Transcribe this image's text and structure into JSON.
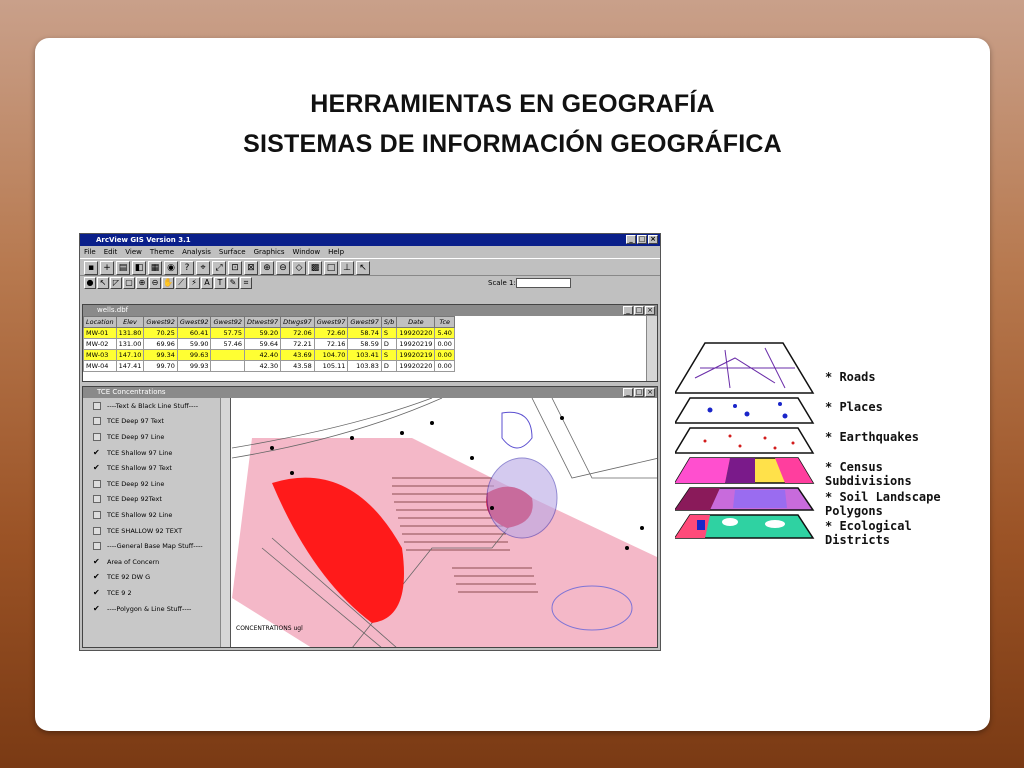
{
  "slide": {
    "title_line1": "HERRAMIENTAS EN GEOGRAFÍA",
    "title_line2": "SISTEMAS DE INFORMACIÓN GEOGRÁFICA"
  },
  "arcview": {
    "window_title": "ArcView GIS Version 3.1",
    "menu": [
      "File",
      "Edit",
      "View",
      "Theme",
      "Analysis",
      "Surface",
      "Graphics",
      "Window",
      "Help"
    ],
    "scale_label": "Scale 1:",
    "table": {
      "title": "wells.dbf",
      "columns": [
        "Location",
        "Elev",
        "Gwest92",
        "Gwest92",
        "Gwest92",
        "Dtwest97",
        "Dtwgs97",
        "Gwest97",
        "Gwest97",
        "S/b",
        "Date",
        "Tce"
      ],
      "rows": [
        {
          "highlight": true,
          "cells": [
            "MW-01",
            "131.80",
            "70.25",
            "60.41",
            "57.75",
            "59.20",
            "72.06",
            "72.60",
            "58.74",
            "S",
            "19920220",
            "5.40"
          ]
        },
        {
          "highlight": false,
          "cells": [
            "MW-02",
            "131.00",
            "69.96",
            "59.90",
            "57.46",
            "59.64",
            "72.21",
            "72.16",
            "58.59",
            "D",
            "19920219",
            "0.00"
          ]
        },
        {
          "highlight": true,
          "cells": [
            "MW-03",
            "147.10",
            "99.34",
            "99.63",
            "",
            "42.40",
            "43.69",
            "104.70",
            "103.41",
            "S",
            "19920219",
            "0.00"
          ]
        },
        {
          "highlight": false,
          "cells": [
            "MW-04",
            "147.41",
            "99.70",
            "99.93",
            "",
            "42.30",
            "43.58",
            "105.11",
            "103.83",
            "D",
            "19920220",
            "0.00"
          ]
        }
      ]
    },
    "map_view": {
      "title": "TCE Concentrations",
      "toc": [
        {
          "label": "----Text & Black Line Stuff----",
          "checked": false
        },
        {
          "label": "TCE Deep 97 Text",
          "checked": false
        },
        {
          "label": "TCE Deep 97 Line",
          "checked": false
        },
        {
          "label": "TCE Shallow 97 Line",
          "checked": true
        },
        {
          "label": "TCE Shallow 97 Text",
          "checked": true
        },
        {
          "label": "TCE Deep 92 Line",
          "checked": false
        },
        {
          "label": "TCE Deep 92Text",
          "checked": false
        },
        {
          "label": "TCE Shallow 92 Line",
          "checked": false
        },
        {
          "label": "TCE SHALLOW 92 TEXT",
          "checked": false
        },
        {
          "label": "----General Base Map Stuff----",
          "checked": false
        },
        {
          "label": "Area of Concern",
          "checked": true
        },
        {
          "label": "TCE 92 DW G",
          "checked": true
        },
        {
          "label": "TCE 9 2",
          "checked": true
        },
        {
          "label": "----Polygon & Line Stuff----",
          "checked": true
        }
      ],
      "map_caption": "CONCENTRATIONS ugl"
    }
  },
  "layers": [
    {
      "label": "* Roads"
    },
    {
      "label": "* Places"
    },
    {
      "label": "* Earthquakes"
    },
    {
      "label": "* Census Subdivisions"
    },
    {
      "label": "* Soil Landscape Polygons"
    },
    {
      "label": "* Ecological Districts"
    }
  ],
  "colors": {
    "titlebar": "#0a1f8a",
    "highlight_row": "#ffff33",
    "plume_red": "#ff1a1a",
    "area_pink": "#f4b8c8"
  }
}
